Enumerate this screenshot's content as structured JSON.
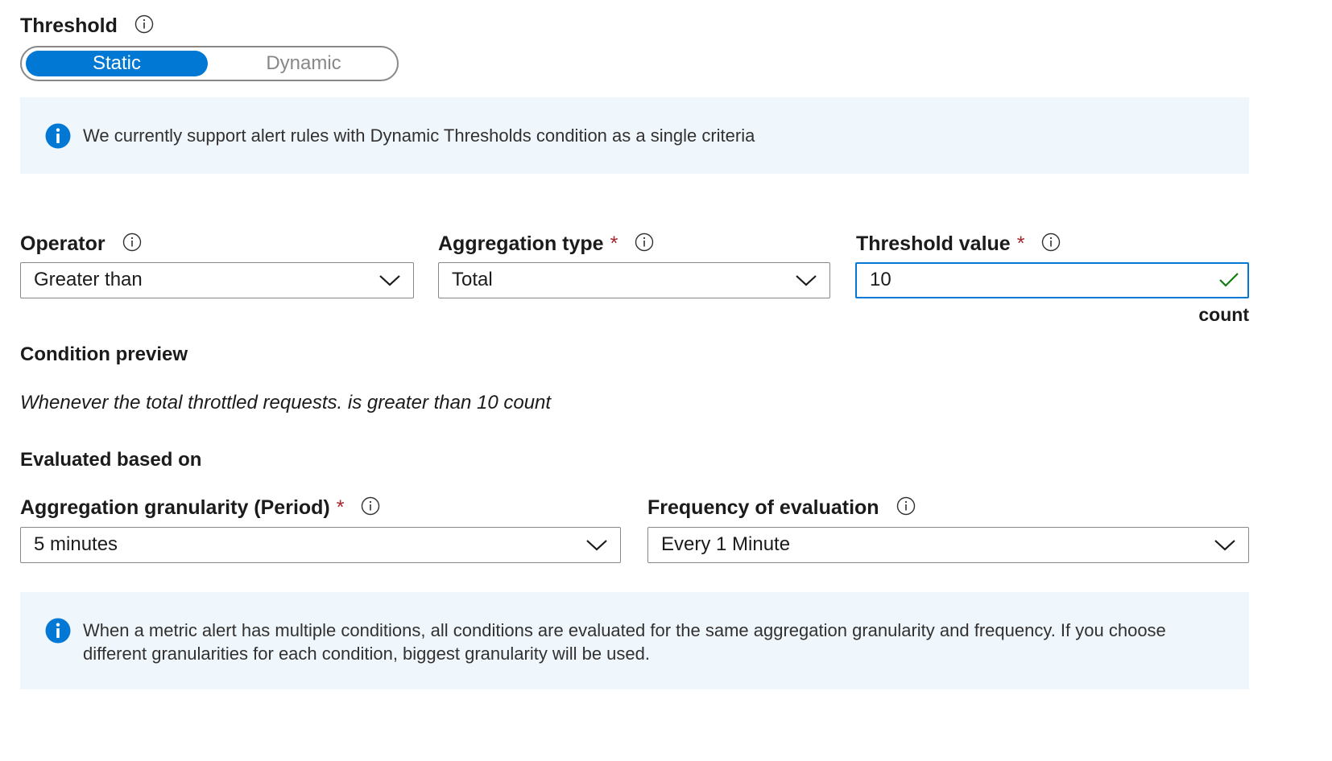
{
  "threshold": {
    "label": "Threshold",
    "options": [
      "Static",
      "Dynamic"
    ],
    "selected": "Static"
  },
  "banner1": {
    "text": "We currently support alert rules with Dynamic Thresholds condition as a single criteria"
  },
  "operator": {
    "label": "Operator",
    "value": "Greater than"
  },
  "aggregation_type": {
    "label": "Aggregation type",
    "required_mark": "*",
    "value": "Total"
  },
  "threshold_value": {
    "label": "Threshold value",
    "required_mark": "*",
    "value": "10",
    "unit": "count"
  },
  "condition_preview": {
    "heading": "Condition preview",
    "text": "Whenever the total throttled requests. is greater than 10 count"
  },
  "evaluated": {
    "heading": "Evaluated based on"
  },
  "granularity": {
    "label": "Aggregation granularity (Period)",
    "required_mark": "*",
    "value": "5 minutes"
  },
  "frequency": {
    "label": "Frequency of evaluation",
    "value": "Every 1 Minute"
  },
  "banner2": {
    "line1": "When a metric alert has multiple conditions, all conditions are evaluated for the same aggregation granularity and frequency. If you choose",
    "line2": "different granularities for each condition, biggest granularity will be used."
  },
  "colors": {
    "accent": "#0078d4",
    "banner_bg": "#eff6fc",
    "required": "#a4262c",
    "valid": "#107c10"
  },
  "icons": {
    "info_outline": "info-icon",
    "info_filled": "info-filled-icon",
    "chevron": "chevron-down-icon",
    "check": "checkmark-icon"
  }
}
